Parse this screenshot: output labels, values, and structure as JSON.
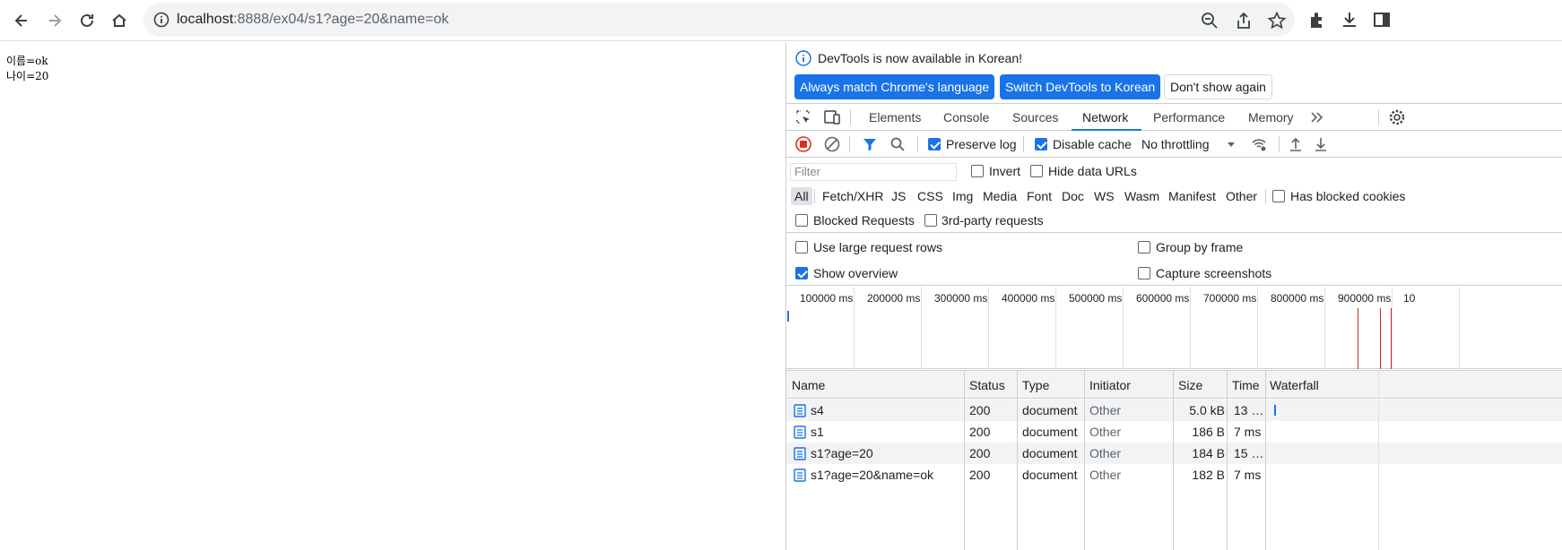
{
  "browser": {
    "url_host": "localhost",
    "url_path": ":8888/ex04/s1?age=20&name=ok"
  },
  "page": {
    "lines": [
      "이름=ok",
      "나이=20"
    ]
  },
  "devtools": {
    "infobar": {
      "message": "DevTools is now available in Korean!",
      "btn_match": "Always match Chrome's language",
      "btn_switch": "Switch DevTools to Korean",
      "btn_dont": "Don't show again"
    },
    "tabs": [
      "Elements",
      "Console",
      "Sources",
      "Network",
      "Performance",
      "Memory"
    ],
    "active_tab": "Network",
    "toolbar": {
      "preserve_log": "Preserve log",
      "disable_cache": "Disable cache",
      "throttling": "No throttling"
    },
    "filter": {
      "placeholder": "Filter",
      "invert": "Invert",
      "hide_data_urls": "Hide data URLs"
    },
    "types": [
      "All",
      "Fetch/XHR",
      "JS",
      "CSS",
      "Img",
      "Media",
      "Font",
      "Doc",
      "WS",
      "Wasm",
      "Manifest",
      "Other"
    ],
    "has_blocked_cookies": "Has blocked cookies",
    "blocked_requests": "Blocked Requests",
    "third_party": "3rd-party requests",
    "settings": {
      "large_rows": "Use large request rows",
      "group_by_frame": "Group by frame",
      "show_overview": "Show overview",
      "capture_screenshots": "Capture screenshots"
    },
    "overview_ticks": [
      "100000 ms",
      "200000 ms",
      "300000 ms",
      "400000 ms",
      "500000 ms",
      "600000 ms",
      "700000 ms",
      "800000 ms",
      "900000 ms",
      "10"
    ],
    "columns": {
      "name": "Name",
      "status": "Status",
      "type": "Type",
      "initiator": "Initiator",
      "size": "Size",
      "time": "Time",
      "waterfall": "Waterfall"
    },
    "rows": [
      {
        "name": "s4",
        "status": "200",
        "type": "document",
        "initiator": "Other",
        "size": "5.0 kB",
        "time": "13 …"
      },
      {
        "name": "s1",
        "status": "200",
        "type": "document",
        "initiator": "Other",
        "size": "186 B",
        "time": "7 ms"
      },
      {
        "name": "s1?age=20",
        "status": "200",
        "type": "document",
        "initiator": "Other",
        "size": "184 B",
        "time": "15 …"
      },
      {
        "name": "s1?age=20&name=ok",
        "status": "200",
        "type": "document",
        "initiator": "Other",
        "size": "182 B",
        "time": "7 ms"
      }
    ]
  }
}
